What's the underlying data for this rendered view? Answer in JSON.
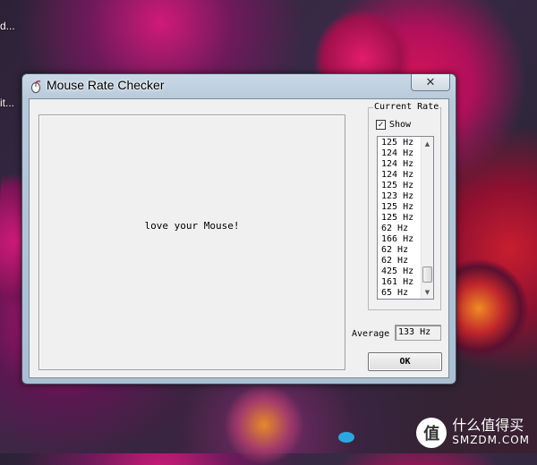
{
  "desktop": {
    "icon_label_1": "d...",
    "icon_label_2": "it..."
  },
  "watermark": {
    "logo_char": "值",
    "cn_text": "什么值得买",
    "en_text": "SMZDM.COM"
  },
  "window": {
    "title": "Mouse Rate Checker",
    "close_symbol": "✕",
    "canvas_message": "love your Mouse!",
    "group_title": "Current Rate",
    "show_label": "Show",
    "show_checked": true,
    "rates": [
      "125 Hz",
      "124 Hz",
      "124 Hz",
      "124 Hz",
      "125 Hz",
      "123 Hz",
      "125 Hz",
      "125 Hz",
      "62 Hz",
      "166 Hz",
      "62 Hz",
      "62 Hz",
      "425 Hz",
      "161 Hz",
      "65 Hz"
    ],
    "average_label": "Average",
    "average_value": "133 Hz",
    "ok_label": "OK"
  },
  "icons": {
    "app_icon": "mouse-app-icon",
    "close": "close-icon",
    "scroll_up": "scroll-up-arrow-icon",
    "scroll_down": "scroll-down-arrow-icon",
    "checkbox": "checkmark-icon"
  }
}
